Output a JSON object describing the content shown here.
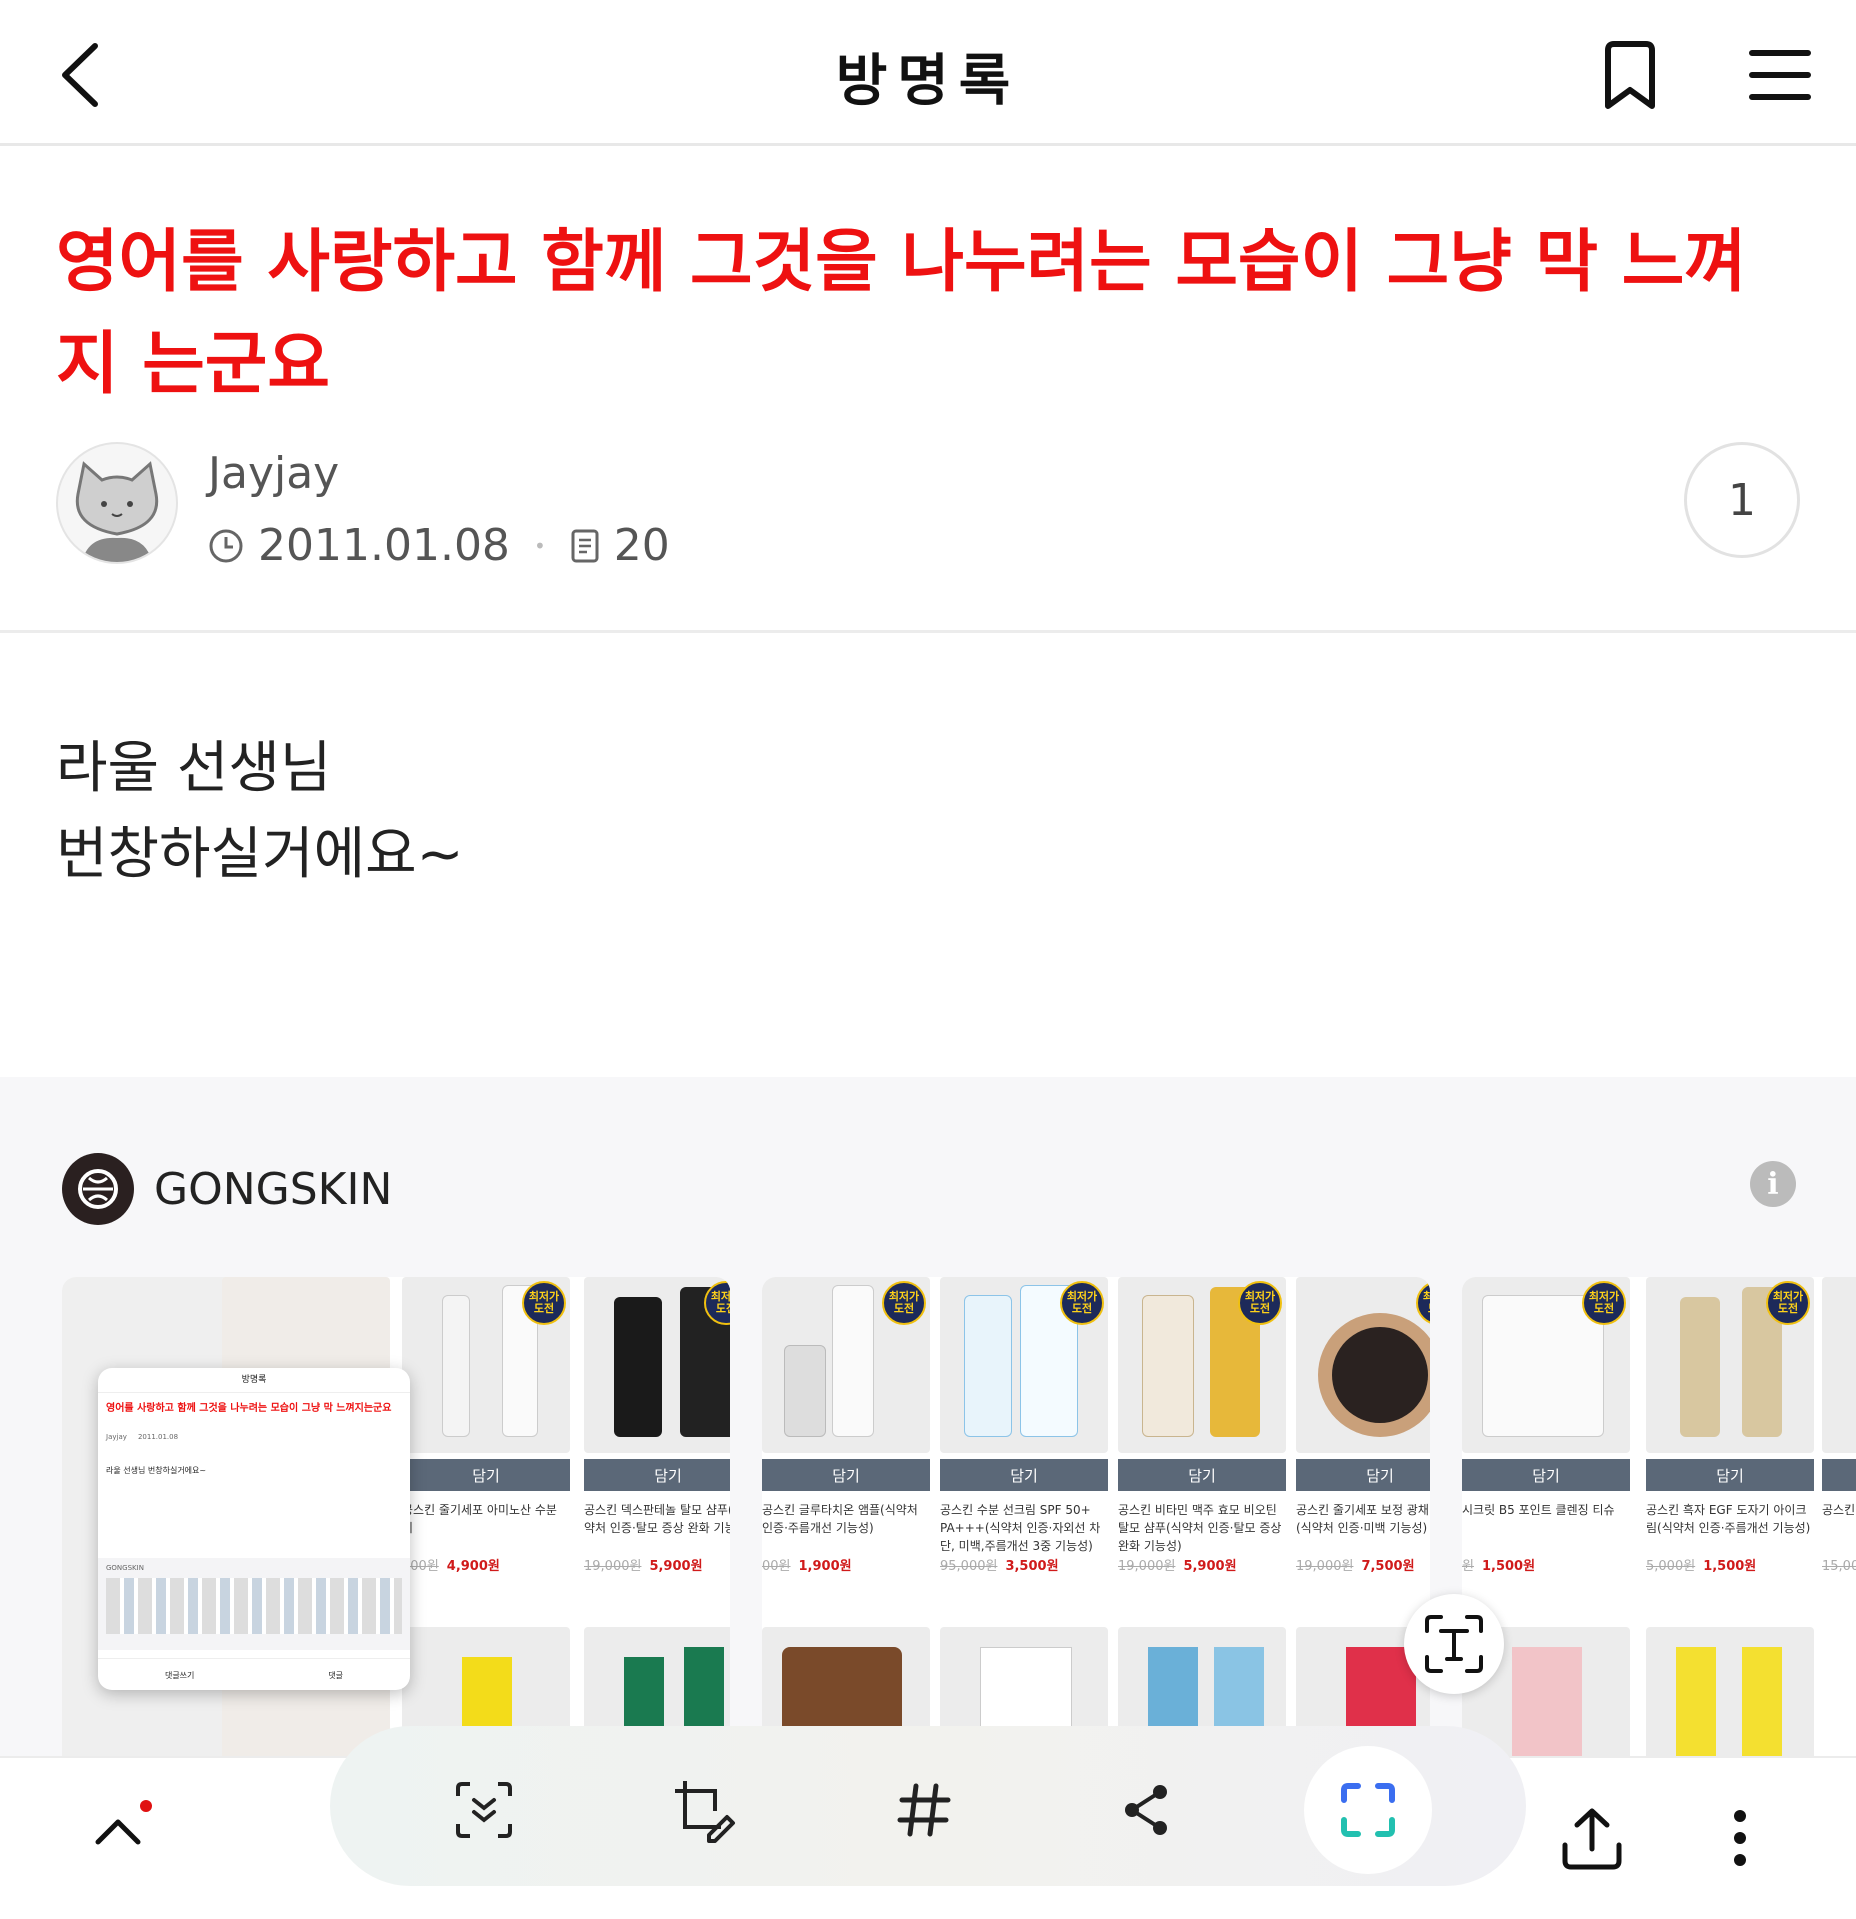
{
  "header": {
    "title": "방명록"
  },
  "post": {
    "title": "영어를 사랑하고 함께 그것을 나누려는 모습이 그냥 막 느껴지 는군요",
    "author": "Jayjay",
    "date": "2011.01.08",
    "views": "20",
    "comment_count": "1",
    "body_line1": "라울 선생님",
    "body_line2": "번창하실거에요~"
  },
  "ad": {
    "brand": "GONGSKIN",
    "info_icon": "i",
    "products": [
      {
        "name": "공스킨 줄기세포 아미노산 수분 미",
        "old_price": "000원",
        "price": "4,900원",
        "cart": "담기"
      },
      {
        "name": "공스킨 덱스판테놀 탈모 샴푸(식약처 인증·탈모 증상 완화 기능성)",
        "old_price": "19,000원",
        "price": "5,900원",
        "cart": "담기"
      },
      {
        "name": "공스킨 글루타치온 앰플(식약처 인증·주름개선 기능성)",
        "old_price": "00원",
        "price": "1,900원",
        "cart": "담기"
      },
      {
        "name": "공스킨 수분 선크림 SPF 50+ PA+++(식약처 인증·자외선 차단, 미백,주름개선 3중 기능성)",
        "old_price": "95,000원",
        "price": "3,500원",
        "cart": "담기"
      },
      {
        "name": "공스킨 비타민 맥주 효모 비오틴 탈모 샴푸(식약처 인증·탈모 증상 완화 기능성)",
        "old_price": "19,000원",
        "price": "5,900원",
        "cart": "담기"
      },
      {
        "name": "공스킨 줄기세포 보정 광채 쿠션(식약처 인증·미백 기능성)",
        "old_price": "19,000원",
        "price": "7,500원",
        "cart": "담기"
      },
      {
        "name": "시크릿 B5 포인트 클렌징 티슈",
        "old_price": "원",
        "price": "1,500원",
        "cart": "담기"
      },
      {
        "name": "공스킨 흑자 EGF 도자기 아이크림(식약처 인증·주름개선 기능성)",
        "old_price": "5,000원",
        "price": "1,500원",
        "cart": "담기"
      },
      {
        "name": "공스킨 마카",
        "old_price": "15,000원",
        "price": "",
        "cart": "담기"
      }
    ],
    "badge": "최저가 도전"
  },
  "thumbnail": {
    "title": "방명록",
    "post_title": "영어를 사랑하고 함께 그것을 나누려는 모습이 그냥 막 느껴지는군요",
    "author": "Jayjay",
    "date": "2011.01.08",
    "body": "라울 선생님 번창하실거에요~",
    "brand": "GONGSKIN",
    "comment_write": "댓글쓰기",
    "comment": "댓글"
  },
  "colors": {
    "accent": "#ee1111",
    "badge_bg": "#1d2a5a",
    "badge_fg": "#ffd21a",
    "cart": "#5b6878"
  }
}
